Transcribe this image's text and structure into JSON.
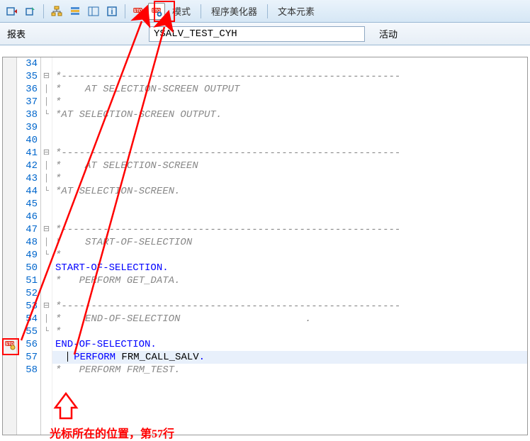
{
  "toolbar": {
    "mode_label": "模式",
    "pretty_label": "程序美化器",
    "text_label": "文本元素"
  },
  "header": {
    "report_label": "报表",
    "report_value": "YSALV_TEST_CYH",
    "status": "活动"
  },
  "editor": {
    "first_line": 34,
    "current_line": 57,
    "breakpoint_line": 56,
    "lines": [
      {
        "n": 34,
        "fold": "",
        "cls": "cmt",
        "txt": ""
      },
      {
        "n": 35,
        "fold": "⊟",
        "cls": "cmt",
        "txt": "*---------------------------------------------------------"
      },
      {
        "n": 36,
        "fold": "│",
        "cls": "cmt",
        "txt": "*    AT SELECTION-SCREEN OUTPUT"
      },
      {
        "n": 37,
        "fold": "│",
        "cls": "cmt",
        "txt": "*"
      },
      {
        "n": 38,
        "fold": "└",
        "cls": "cmt",
        "txt": "*AT SELECTION-SCREEN OUTPUT."
      },
      {
        "n": 39,
        "fold": "",
        "cls": "cmt",
        "txt": ""
      },
      {
        "n": 40,
        "fold": "",
        "cls": "cmt",
        "txt": ""
      },
      {
        "n": 41,
        "fold": "⊟",
        "cls": "cmt",
        "txt": "*---------------------------------------------------------"
      },
      {
        "n": 42,
        "fold": "│",
        "cls": "cmt",
        "txt": "*    AT SELECTION-SCREEN"
      },
      {
        "n": 43,
        "fold": "│",
        "cls": "cmt",
        "txt": "*"
      },
      {
        "n": 44,
        "fold": "└",
        "cls": "cmt",
        "txt": "*AT SELECTION-SCREEN."
      },
      {
        "n": 45,
        "fold": "",
        "cls": "cmt",
        "txt": ""
      },
      {
        "n": 46,
        "fold": "",
        "cls": "cmt",
        "txt": ""
      },
      {
        "n": 47,
        "fold": "⊟",
        "cls": "cmt",
        "txt": "*---------------------------------------------------------"
      },
      {
        "n": 48,
        "fold": "│",
        "cls": "cmt",
        "txt": "*    START-OF-SELECTION"
      },
      {
        "n": 49,
        "fold": "└",
        "cls": "cmt",
        "txt": "*"
      },
      {
        "n": 50,
        "fold": "",
        "cls": "kw",
        "txt": "START-OF-SELECTION."
      },
      {
        "n": 51,
        "fold": "",
        "cls": "cmt",
        "txt": "*   PERFORM GET_DATA."
      },
      {
        "n": 52,
        "fold": "",
        "cls": "cmt",
        "txt": ""
      },
      {
        "n": 53,
        "fold": "⊟",
        "cls": "cmt",
        "txt": "*---------------------------------------------------------"
      },
      {
        "n": 54,
        "fold": "│",
        "cls": "cmt",
        "txt": "*    END-OF-SELECTION                     ."
      },
      {
        "n": 55,
        "fold": "└",
        "cls": "cmt",
        "txt": "*"
      },
      {
        "n": 56,
        "fold": "",
        "cls": "kw",
        "txt": "END-OF-SELECTION."
      },
      {
        "n": 57,
        "fold": "",
        "cls": "mix",
        "txt": "  PERFORM FRM_CALL_SALV."
      },
      {
        "n": 58,
        "fold": "",
        "cls": "cmt",
        "txt": "*   PERFORM FRM_TEST."
      }
    ]
  },
  "annotation": {
    "caption": "光标所在的位置，第57行"
  }
}
